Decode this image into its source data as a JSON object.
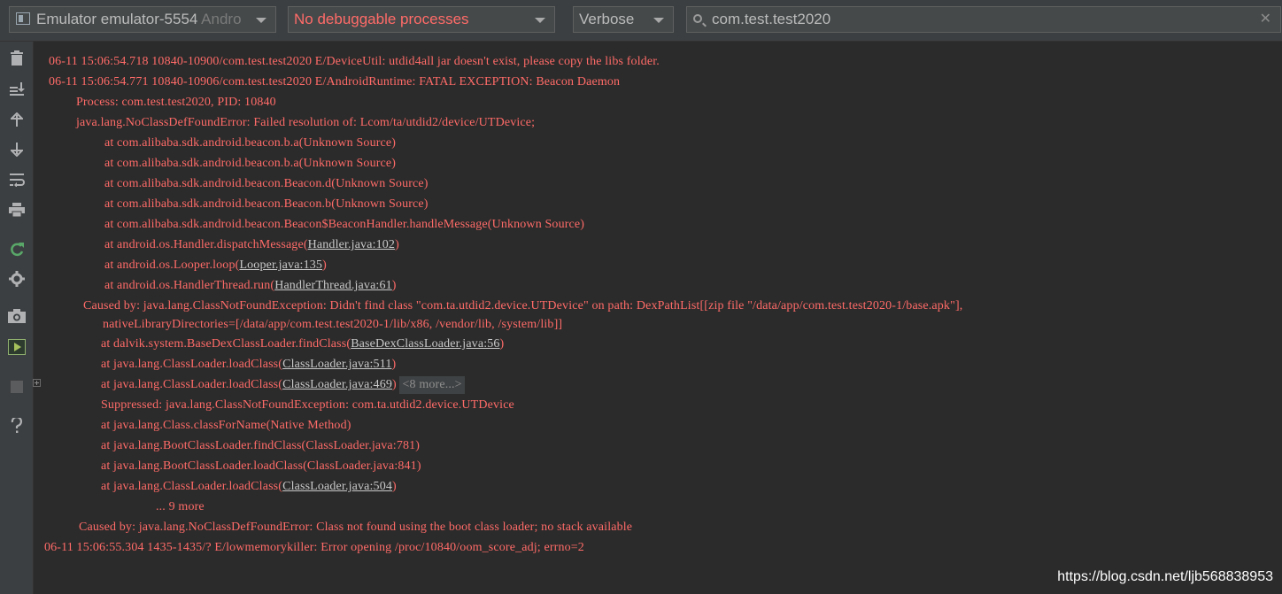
{
  "toolbar": {
    "device": {
      "main": "Emulator emulator-5554",
      "dim": " Andro"
    },
    "process": "No debuggable processes",
    "level": "Verbose",
    "search": "com.test.test2020",
    "clear": "✕"
  },
  "tools": [
    "trash-icon",
    "scroll-to-end-icon",
    "up-arrow-icon",
    "down-arrow-icon",
    "soft-wrap-icon",
    "print-icon",
    "restart-icon",
    "gear-icon",
    "screenshot-icon",
    "screen-record-icon",
    "stop-icon",
    "help-icon"
  ],
  "log": {
    "l1": "06-11 15:06:54.718 10840-10900/com.test.test2020 E/DeviceUtil: utdid4all jar doesn't exist, please copy the libs folder.",
    "l2": "06-11 15:06:54.771 10840-10906/com.test.test2020 E/AndroidRuntime: FATAL EXCEPTION: Beacon Daemon",
    "l3": "Process: com.test.test2020, PID: 10840",
    "l4": "java.lang.NoClassDefFoundError: Failed resolution of: Lcom/ta/utdid2/device/UTDevice;",
    "l5": "at com.alibaba.sdk.android.beacon.b.a(Unknown Source)",
    "l6": "at com.alibaba.sdk.android.beacon.b.a(Unknown Source)",
    "l7": "at com.alibaba.sdk.android.beacon.Beacon.d(Unknown Source)",
    "l8": "at com.alibaba.sdk.android.beacon.Beacon.b(Unknown Source)",
    "l9": "at com.alibaba.sdk.android.beacon.Beacon$BeaconHandler.handleMessage(Unknown Source)",
    "l10_pre": "at android.os.Handler.dispatchMessage(",
    "l10_link": "Handler.java:102",
    "l11_pre": "at android.os.Looper.loop(",
    "l11_link": "Looper.java:135",
    "l12_pre": "at android.os.HandlerThread.run(",
    "l12_link": "HandlerThread.java:61",
    "l13": "Caused by: java.lang.ClassNotFoundException: Didn't find class \"com.ta.utdid2.device.UTDevice\" on path: DexPathList[[zip file \"/data/app/com.test.test2020-1/base.apk\"],",
    "l14": "nativeLibraryDirectories=[/data/app/com.test.test2020-1/lib/x86, /vendor/lib, /system/lib]]",
    "l15_pre": "at dalvik.system.BaseDexClassLoader.findClass(",
    "l15_link": "BaseDexClassLoader.java:56",
    "l16_pre": "at java.lang.ClassLoader.loadClass(",
    "l16_link": "ClassLoader.java:511",
    "l17_pre": "at java.lang.ClassLoader.loadClass(",
    "l17_link": "ClassLoader.java:469",
    "l17_more": "<8 more...>",
    "l18": "Suppressed: java.lang.ClassNotFoundException: com.ta.utdid2.device.UTDevice",
    "l19": "at java.lang.Class.classForName(Native Method)",
    "l20": "at java.lang.BootClassLoader.findClass(ClassLoader.java:781)",
    "l21": "at java.lang.BootClassLoader.loadClass(ClassLoader.java:841)",
    "l22_pre": "at java.lang.ClassLoader.loadClass(",
    "l22_link": "ClassLoader.java:504",
    "l23": "... 9 more",
    "l24": "Caused by: java.lang.NoClassDefFoundError: Class not found using the boot class loader; no stack available",
    "l25": "06-11 15:06:55.304 1435-1435/? E/lowmemorykiller: Error opening /proc/10840/oom_score_adj; errno=2",
    "close": ")"
  },
  "watermark": "https://blog.csdn.net/ljb568838953"
}
